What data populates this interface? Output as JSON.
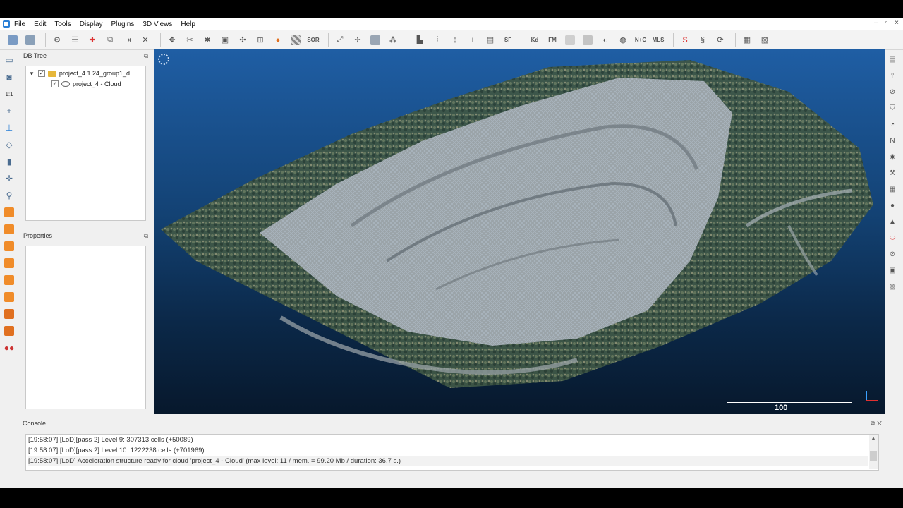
{
  "menu": [
    "File",
    "Edit",
    "Tools",
    "Display",
    "Plugins",
    "3D Views",
    "Help"
  ],
  "window_controls": [
    "–",
    "▫",
    "×"
  ],
  "toolbar_text": {
    "sf": "SF",
    "sor": "SOR",
    "kd": "Kd",
    "fm": "FM",
    "nc": "N+C",
    "mls": "MLS"
  },
  "db_tree": {
    "title": "DB Tree",
    "group_label": "project_4.1.24_group1_d...",
    "cloud_label": "project_4 - Cloud"
  },
  "properties": {
    "title": "Properties"
  },
  "viewport": {
    "scale_label": "100"
  },
  "console": {
    "title": "Console",
    "lines": [
      "[19:58:07] [LoD][pass 2] Level 9: 307313 cells (+50089)",
      "[19:58:07] [LoD][pass 2] Level 10: 1222238 cells (+701969)",
      "[19:58:07] [LoD] Acceleration structure ready for cloud 'project_4 - Cloud' (max level: 11 / mem. = 99.20 Mb / duration: 36.7 s.)"
    ]
  },
  "colors": {
    "accent": "#2a7fd6",
    "cube": "#f08c2a",
    "view_top": "#1f5ea4",
    "view_bottom": "#07182c"
  }
}
